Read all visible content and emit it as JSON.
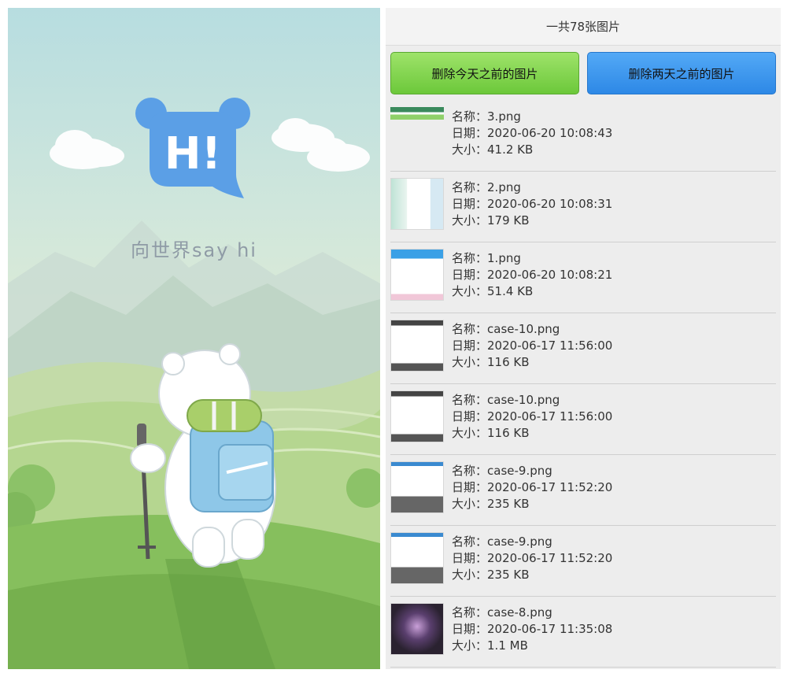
{
  "splash": {
    "logo_text": "H!",
    "slogan": "向世界say hi"
  },
  "panel": {
    "title": "一共78张图片",
    "buttons": {
      "delete_before_today": "删除今天之前的图片",
      "delete_before_two_days": "删除两天之前的图片"
    },
    "labels": {
      "name": "名称：",
      "date": "日期：",
      "size": "大小："
    },
    "items": [
      {
        "name": "3.png",
        "date": "2020-06-20 10:08:43",
        "size": "41.2 KB",
        "thumb_icon": "screenshot-thumbnail"
      },
      {
        "name": "2.png",
        "date": "2020-06-20 10:08:31",
        "size": "179 KB",
        "thumb_icon": "screenshot-thumbnail"
      },
      {
        "name": "1.png",
        "date": "2020-06-20 10:08:21",
        "size": "51.4 KB",
        "thumb_icon": "screenshot-thumbnail"
      },
      {
        "name": "case-10.png",
        "date": "2020-06-17 11:56:00",
        "size": "116 KB",
        "thumb_icon": "screenshot-thumbnail"
      },
      {
        "name": "case-10.png",
        "date": "2020-06-17 11:56:00",
        "size": "116 KB",
        "thumb_icon": "screenshot-thumbnail"
      },
      {
        "name": "case-9.png",
        "date": "2020-06-17 11:52:20",
        "size": "235 KB",
        "thumb_icon": "screenshot-thumbnail"
      },
      {
        "name": "case-9.png",
        "date": "2020-06-17 11:52:20",
        "size": "235 KB",
        "thumb_icon": "screenshot-thumbnail"
      },
      {
        "name": "case-8.png",
        "date": "2020-06-17 11:35:08",
        "size": "1.1 MB",
        "thumb_icon": "screenshot-thumbnail"
      }
    ]
  },
  "colors": {
    "green_button": "#6cc83a",
    "blue_button": "#2d88e6",
    "logo_blue": "#5b9fe6"
  }
}
